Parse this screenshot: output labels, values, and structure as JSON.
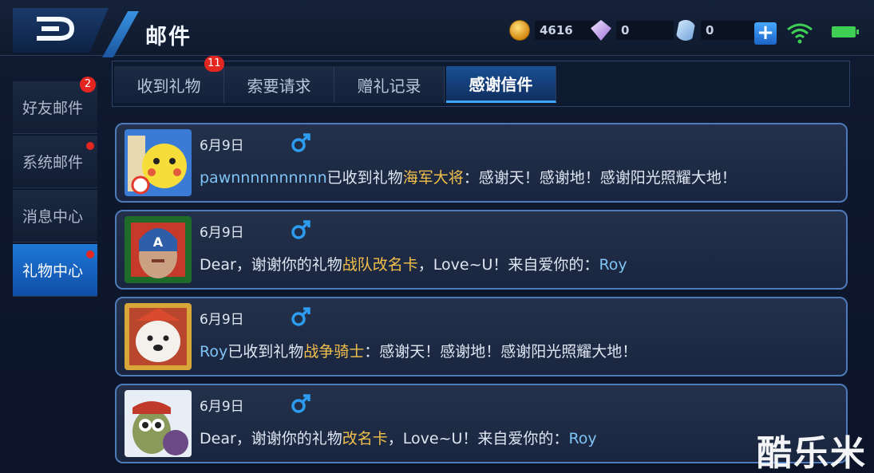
{
  "header": {
    "title": "邮件"
  },
  "currencies": [
    {
      "icon": "gold-coin-icon",
      "value": "4616"
    },
    {
      "icon": "gem-icon",
      "value": "0"
    },
    {
      "icon": "card-icon",
      "value": "0"
    }
  ],
  "sidebar": {
    "items": [
      {
        "label": "好友邮件",
        "badge": "2"
      },
      {
        "label": "系统邮件"
      },
      {
        "label": "消息中心"
      },
      {
        "label": "礼物中心"
      }
    ]
  },
  "tabs": [
    {
      "label": "收到礼物",
      "badge": "11"
    },
    {
      "label": "索要请求"
    },
    {
      "label": "赠礼记录"
    },
    {
      "label": "感谢信件"
    }
  ],
  "messages": [
    {
      "date": "6月9日",
      "parts": [
        "pawnnnnnnnnnn",
        "已收到礼物",
        "海军大将",
        "：感谢天！感谢地！感谢阳光照耀大地！"
      ]
    },
    {
      "date": "6月9日",
      "parts": [
        "Dear，谢谢你的礼物",
        "战队改名卡",
        "，Love~U！来自爱你的：",
        "Roy"
      ]
    },
    {
      "date": "6月9日",
      "parts": [
        "Roy",
        "已收到礼物",
        "战争骑士",
        "：感谢天！感谢地！感谢阳光照耀大地！"
      ]
    },
    {
      "date": "6月9日",
      "parts": [
        "Dear，谢谢你的礼物",
        "改名卡",
        "，Love~U！来自爱你的：",
        "Roy"
      ]
    }
  ],
  "watermark": "酷乐米",
  "colors": {
    "accent": "#3fa7ff",
    "username": "#7ec3f4",
    "gift": "#f2c04a",
    "badge": "#e3261f",
    "gender": "#2d9cf0"
  }
}
